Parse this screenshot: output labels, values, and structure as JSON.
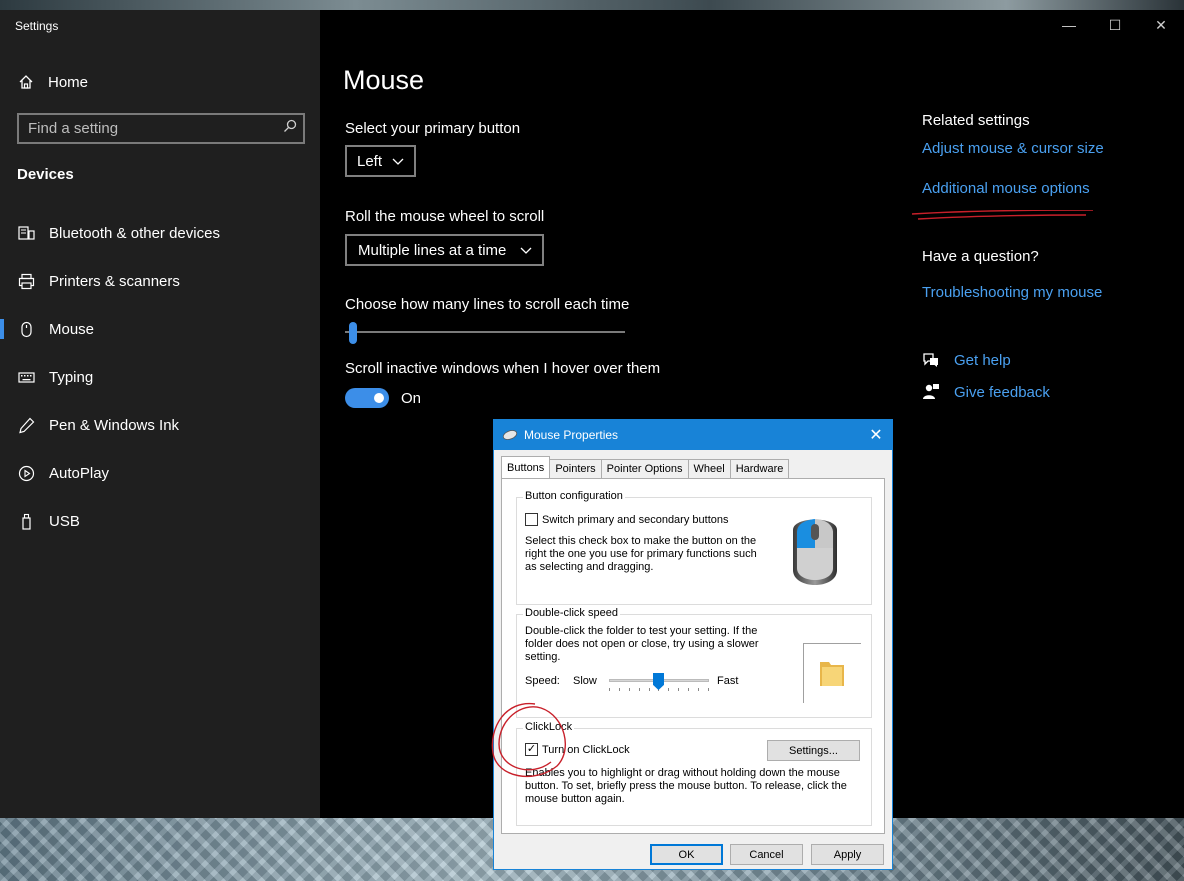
{
  "window": {
    "title": "Settings",
    "controls": [
      "minimize",
      "maximize",
      "close"
    ]
  },
  "sidebar": {
    "home_label": "Home",
    "search_placeholder": "Find a setting",
    "section_title": "Devices",
    "items": [
      {
        "label": "Bluetooth & other devices",
        "icon": "bluetooth-devices-icon",
        "active": false
      },
      {
        "label": "Printers & scanners",
        "icon": "printer-icon",
        "active": false
      },
      {
        "label": "Mouse",
        "icon": "mouse-icon",
        "active": true
      },
      {
        "label": "Typing",
        "icon": "keyboard-icon",
        "active": false
      },
      {
        "label": "Pen & Windows Ink",
        "icon": "pen-icon",
        "active": false
      },
      {
        "label": "AutoPlay",
        "icon": "autoplay-icon",
        "active": false
      },
      {
        "label": "USB",
        "icon": "usb-icon",
        "active": false
      }
    ]
  },
  "main": {
    "page_title": "Mouse",
    "primary_button": {
      "label": "Select your primary button",
      "value": "Left"
    },
    "scroll_wheel": {
      "label": "Roll the mouse wheel to scroll",
      "value": "Multiple lines at a time"
    },
    "lines_slider": {
      "label": "Choose how many lines to scroll each time",
      "value_fraction": 0.03
    },
    "inactive_scroll": {
      "label": "Scroll inactive windows when I hover over them",
      "state": "On"
    }
  },
  "related": {
    "heading": "Related settings",
    "links": [
      "Adjust mouse & cursor size",
      "Additional mouse options"
    ],
    "question_heading": "Have a question?",
    "question_link": "Troubleshooting my mouse",
    "help_link": "Get help",
    "feedback_link": "Give feedback"
  },
  "dialog": {
    "title": "Mouse Properties",
    "tabs": [
      "Buttons",
      "Pointers",
      "Pointer Options",
      "Wheel",
      "Hardware"
    ],
    "active_tab": "Buttons",
    "button_config": {
      "title": "Button configuration",
      "checkbox_label": "Switch primary and secondary buttons",
      "checked": false,
      "description": "Select this check box to make the button on the right the one you use for primary functions such as selecting and dragging."
    },
    "double_click": {
      "title": "Double-click speed",
      "description": "Double-click the folder to test your setting. If the folder does not open or close, try using a slower setting.",
      "speed_label": "Speed:",
      "slow_label": "Slow",
      "fast_label": "Fast",
      "speed_fraction": 0.5
    },
    "clicklock": {
      "title": "ClickLock",
      "checkbox_label": "Turn on ClickLock",
      "checked": true,
      "settings_button": "Settings...",
      "description": "Enables you to highlight or drag without holding down the mouse button. To set, briefly press the mouse button. To release, click the mouse button again."
    },
    "buttons": {
      "ok": "OK",
      "cancel": "Cancel",
      "apply": "Apply"
    }
  },
  "colors": {
    "accent": "#3c8ee8",
    "link": "#4aa0f0",
    "dialog_titlebar": "#1883d7",
    "annotation": "#c8202a"
  }
}
